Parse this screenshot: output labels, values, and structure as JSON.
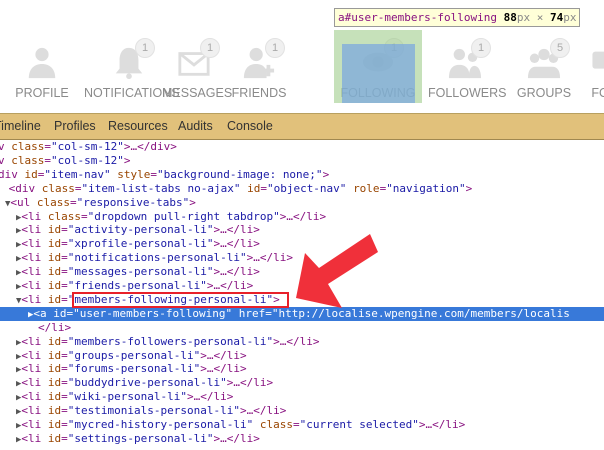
{
  "nav": {
    "tabs": [
      {
        "label": "PROFILE",
        "icon": "person-icon",
        "badge": ""
      },
      {
        "label": "NOTIFICATIONS",
        "icon": "bell-icon",
        "badge": "1"
      },
      {
        "label": "MESSAGES",
        "icon": "envelope-icon",
        "badge": "1"
      },
      {
        "label": "FRIENDS",
        "icon": "person-add-icon",
        "badge": "1"
      },
      {
        "label": "FOLLOWING",
        "icon": "eye-icon",
        "badge": "1"
      },
      {
        "label": "FOLLOWERS",
        "icon": "people-icon",
        "badge": "1"
      },
      {
        "label": "GROUPS",
        "icon": "group-icon",
        "badge": "5"
      },
      {
        "label": "FO",
        "icon": "forum-icon",
        "badge": ""
      }
    ]
  },
  "tooltip": {
    "tag": "a",
    "id": "#user-members-following",
    "w": "88",
    "h": "74",
    "unit": "px",
    "times": "×"
  },
  "devtools": {
    "tabs": [
      "Timeline",
      "Profiles",
      "Resources",
      "Audits",
      "Console"
    ]
  },
  "code": {
    "lines": [
      "v class=\"col-sm-12\">…</div>",
      "v class=\"col-sm-12\">",
      "div id=\"item-nav\" style=\"background-image: none;\">",
      " <div class=\"item-list-tabs no-ajax\" id=\"object-nav\" role=\"navigation\">",
      "<ul class=\"responsive-tabs\">",
      "<li class=\"dropdown pull-right tabdrop\">…</li>",
      "<li id=\"activity-personal-li\">…</li>",
      "<li id=\"xprofile-personal-li\">…</li>",
      "<li id=\"notifications-personal-li\">…</li>",
      "<li id=\"messages-personal-li\">…</li>",
      "<li id=\"friends-personal-li\">…</li>",
      "<li id=\"members-following-personal-li\">",
      "<a id=\"user-members-following\" href=\"http://localise.wpengine.com/members/localis",
      "</li>",
      "<li id=\"members-followers-personal-li\">…</li>",
      "<li id=\"groups-personal-li\">…</li>",
      "<li id=\"forums-personal-li\">…</li>",
      "<li id=\"buddydrive-personal-li\">…</li>",
      "<li id=\"wiki-personal-li\">…</li>",
      "<li id=\"testimonials-personal-li\">…</li>",
      "<li id=\"mycred-history-personal-li\" class=\"current selected\">…</li>",
      "<li id=\"settings-personal-li\">…</li>"
    ]
  },
  "colors": {
    "toolbar": "#e1c17b",
    "selection": "#3879d9",
    "annotation": "#e8202a"
  }
}
